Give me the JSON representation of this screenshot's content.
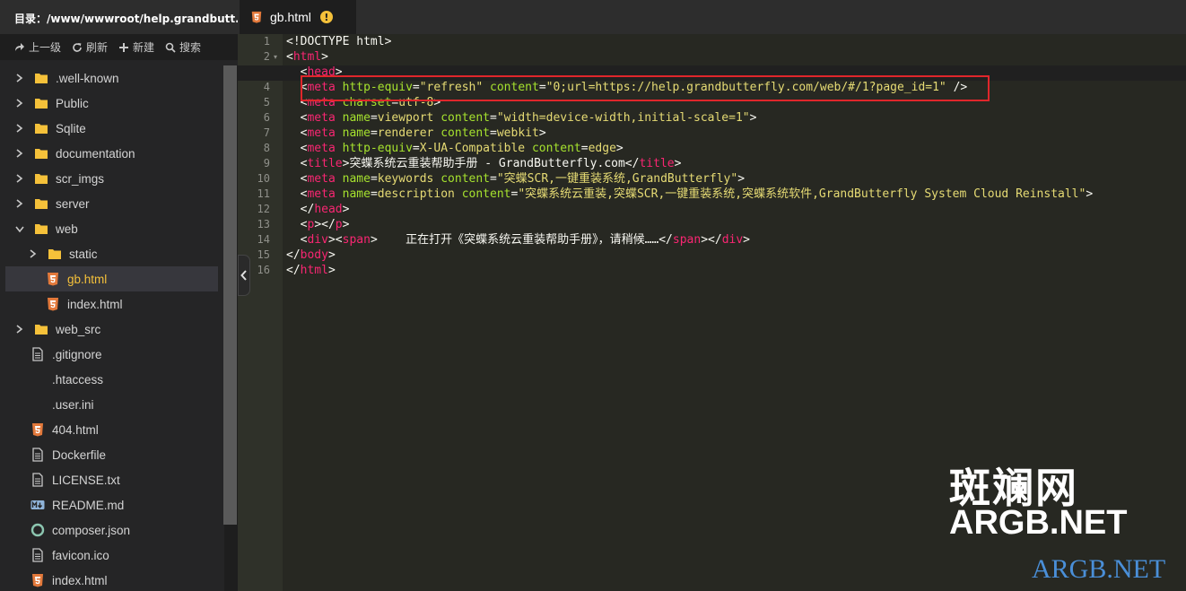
{
  "sidebar": {
    "title": "目录：/www/wwwroot/help.grandbutt...",
    "toolbar": {
      "up": "上一级",
      "refresh": "刷新",
      "new": "新建",
      "search": "搜索"
    },
    "items": [
      {
        "label": ".well-known",
        "type": "folder",
        "expanded": false
      },
      {
        "label": "Public",
        "type": "folder",
        "expanded": false
      },
      {
        "label": "Sqlite",
        "type": "folder",
        "expanded": false
      },
      {
        "label": "documentation",
        "type": "folder",
        "expanded": false
      },
      {
        "label": "scr_imgs",
        "type": "folder",
        "expanded": false
      },
      {
        "label": "server",
        "type": "folder",
        "expanded": false
      },
      {
        "label": "web",
        "type": "folder",
        "expanded": true
      },
      {
        "label": "static",
        "type": "folder",
        "expanded": false
      },
      {
        "label": "gb.html",
        "type": "html-file",
        "selected": true
      },
      {
        "label": "index.html",
        "type": "html-file"
      },
      {
        "label": "web_src",
        "type": "folder",
        "expanded": false
      },
      {
        "label": ".gitignore",
        "type": "text-file"
      },
      {
        "label": ".htaccess",
        "type": "plain"
      },
      {
        "label": ".user.ini",
        "type": "plain"
      },
      {
        "label": "404.html",
        "type": "html-file"
      },
      {
        "label": "Dockerfile",
        "type": "text-file"
      },
      {
        "label": "LICENSE.txt",
        "type": "text-file"
      },
      {
        "label": "README.md",
        "type": "md-file"
      },
      {
        "label": "composer.json",
        "type": "json-file"
      },
      {
        "label": "favicon.ico",
        "type": "text-file"
      },
      {
        "label": "index.html",
        "type": "html-file"
      }
    ]
  },
  "tab": {
    "label": "gb.html",
    "warning_icon": "!"
  },
  "editor": {
    "line_numbers": [
      "1",
      "2",
      "3",
      "4",
      "5",
      "6",
      "7",
      "8",
      "9",
      "10",
      "11",
      "12",
      "13",
      "14",
      "15",
      "16"
    ],
    "lines": {
      "l1": {
        "a": "<!DOCTYPE html>"
      },
      "l2": {
        "a": "<",
        "b": "html",
        "c": ">"
      },
      "l3": {
        "a": "  <",
        "b": "head",
        "c": ">"
      },
      "l4": {
        "a": "  <",
        "b": "meta",
        "c": " ",
        "d": "http-equiv",
        "e": "=",
        "f": "\"refresh\"",
        "g": " ",
        "h": "content",
        "i": "=",
        "j": "\"0;url=https://help.grandbutterfly.com/web/#/1?page_id=1\"",
        "k": " />"
      },
      "l5": {
        "a": "  <",
        "b": "meta",
        "c": " ",
        "d": "charset",
        "e": "=",
        "f": "utf-8",
        "g": ">"
      },
      "l6": {
        "a": "  <",
        "b": "meta",
        "c": " ",
        "d": "name",
        "e": "=",
        "f": "viewport",
        "g": " ",
        "h": "content",
        "i": "=",
        "j": "\"width=device-width,initial-scale=1\"",
        "k": ">"
      },
      "l7": {
        "a": "  <",
        "b": "meta",
        "c": " ",
        "d": "name",
        "e": "=",
        "f": "renderer",
        "g": " ",
        "h": "content",
        "i": "=",
        "j": "webkit",
        "k": ">"
      },
      "l8": {
        "a": "  <",
        "b": "meta",
        "c": " ",
        "d": "http-equiv",
        "e": "=",
        "f": "X-UA-Compatible",
        "g": " ",
        "h": "content",
        "i": "=",
        "j": "edge",
        "k": ">"
      },
      "l9": {
        "a": "  <",
        "b": "title",
        "c": ">突蝶系统云重装帮助手册 - GrandButterfly.com</",
        "d": "title",
        "e": ">"
      },
      "l10": {
        "a": "  <",
        "b": "meta",
        "c": " ",
        "d": "name",
        "e": "=",
        "f": "keywords",
        "g": " ",
        "h": "content",
        "i": "=",
        "j": "\"突蝶SCR,一键重装系统,GrandButterfly\"",
        "k": ">"
      },
      "l11": {
        "a": "  <",
        "b": "meta",
        "c": " ",
        "d": "name",
        "e": "=",
        "f": "description",
        "g": " ",
        "h": "content",
        "i": "=",
        "j": "\"突蝶系统云重装,突蝶SCR,一键重装系统,突蝶系统软件,GrandButterfly System Cloud Reinstall\"",
        "k": ">"
      },
      "l12": {
        "a": "  </",
        "b": "head",
        "c": ">"
      },
      "l13": {
        "a": "  <",
        "b": "p",
        "c": "></",
        "d": "p",
        "e": ">"
      },
      "l14": {
        "a": "  <",
        "b": "div",
        "c": "><",
        "d": "span",
        "e": ">    正在打开《突蝶系统云重装帮助手册》，请稍候……</",
        "f": "span",
        "g": "></",
        "h": "div",
        "i": ">"
      },
      "l15": {
        "a": "</",
        "b": "body",
        "c": ">"
      },
      "l16": {
        "a": "</",
        "b": "html",
        "c": ">"
      }
    }
  },
  "watermark": {
    "cn": "斑斓网",
    "en": "ARGB.NET",
    "en2": "ARGB.NET"
  },
  "colors": {
    "tag": "#f92672",
    "attr": "#a6e22e",
    "string": "#e6db74",
    "selected_file": "#f5c13a",
    "highlight_box": "#e0262b",
    "watermark_blue": "#4a8fd8"
  }
}
